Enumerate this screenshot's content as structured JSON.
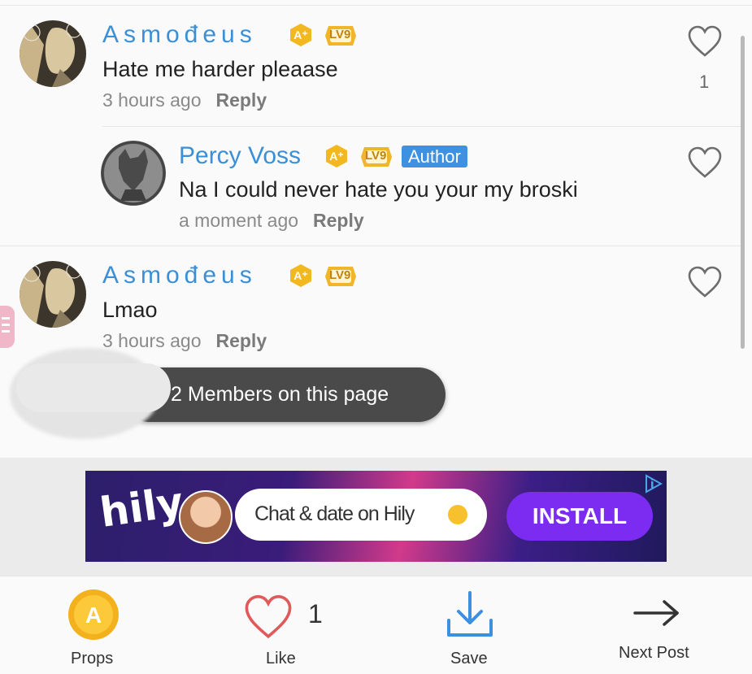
{
  "comments": [
    {
      "author": "Asmodeus",
      "author_display": "Asmođeus",
      "badge_level": "LV9",
      "text": "Hate me harder pleaase",
      "time": "3 hours ago",
      "reply_label": "Reply",
      "likes": "1"
    },
    {
      "author": "Percy Voss",
      "badge_level": "LV9",
      "author_tag": "Author",
      "text": "Na I could never hate you your my broski",
      "time": "a moment ago",
      "reply_label": "Reply"
    },
    {
      "author": "Asmodeus",
      "author_display": "Asmođeus",
      "badge_level": "LV9",
      "text": "Lmao",
      "time": "3 hours ago",
      "reply_label": "Reply"
    }
  ],
  "members_pill": {
    "text": "2 Members on this page"
  },
  "ad": {
    "brand": "hily",
    "chat_text": "Chat & date on Hily",
    "cta": "INSTALL"
  },
  "bottom_bar": {
    "props_label": "Props",
    "like_label": "Like",
    "like_count": "1",
    "save_label": "Save",
    "next_label": "Next Post"
  },
  "colors": {
    "accent_blue": "#3a8fd6",
    "badge_gold": "#f2b81f",
    "like_red": "#e05a5a",
    "save_blue": "#3d8fe0"
  }
}
